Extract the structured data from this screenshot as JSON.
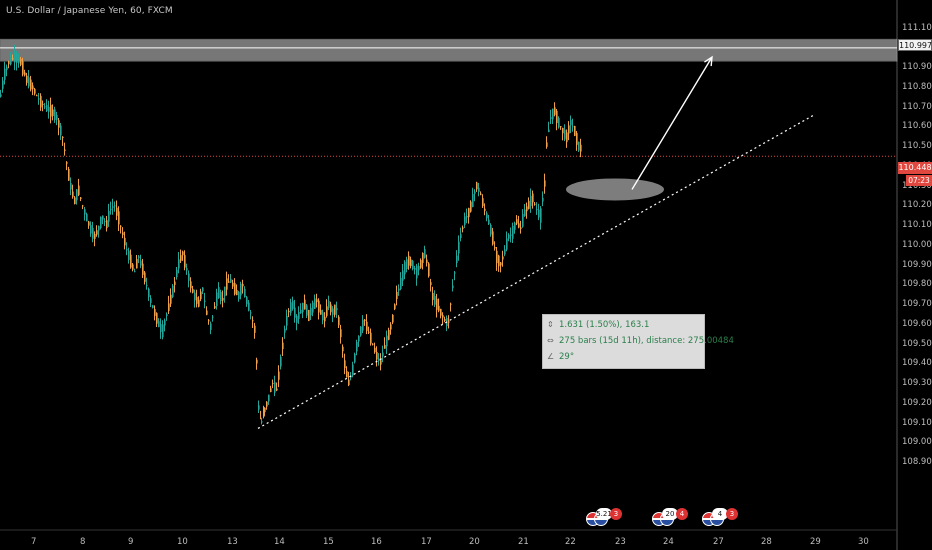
{
  "symbol_title": "U.S. Dollar / Japanese Yen, 60, FXCM",
  "colors": {
    "background": "#000000",
    "candle_up": "#26a69a",
    "candle_down": "#f0a04b",
    "price_line": "#e0483f",
    "zone": "#d9d9d9",
    "trendline": "#ffffff"
  },
  "price_badge": {
    "value": "110.448",
    "countdown": "07:23"
  },
  "level_badge": {
    "value": "110.997"
  },
  "measure": {
    "line1": "1.631 (1.50%), 163.1",
    "line2": "275 bars (15d 11h), distance: 275.00484",
    "line3": "29°",
    "icon1": "vertical-measure-icon",
    "icon2": "horizontal-measure-icon",
    "icon3": "angle-icon"
  },
  "events": [
    {
      "label": "5.21",
      "count": "3"
    },
    {
      "label": "20",
      "count": "4"
    },
    {
      "label": "4",
      "count": "3"
    }
  ],
  "chart_data": {
    "type": "candlestick",
    "ylim": [
      108.85,
      111.18
    ],
    "yticks": [
      "111.100",
      "111.000",
      "110.900",
      "110.800",
      "110.700",
      "110.600",
      "110.500",
      "110.400",
      "110.300",
      "110.200",
      "110.100",
      "110.000",
      "109.900",
      "109.800",
      "109.700",
      "109.600",
      "109.500",
      "109.400",
      "109.300",
      "109.200",
      "109.100",
      "109.000",
      "108.900"
    ],
    "xticks": [
      "7",
      "8",
      "9",
      "10",
      "13",
      "14",
      "15",
      "16",
      "17",
      "20",
      "21",
      "22",
      "23",
      "24",
      "27",
      "28",
      "29",
      "30"
    ],
    "series_path": [
      [
        0,
        110.75
      ],
      [
        4,
        110.86
      ],
      [
        8,
        110.92
      ],
      [
        14,
        110.95
      ],
      [
        20,
        110.93
      ],
      [
        26,
        110.84
      ],
      [
        32,
        110.8
      ],
      [
        38,
        110.74
      ],
      [
        44,
        110.7
      ],
      [
        50,
        110.68
      ],
      [
        56,
        110.65
      ],
      [
        62,
        110.55
      ],
      [
        66,
        110.42
      ],
      [
        70,
        110.3
      ],
      [
        74,
        110.22
      ],
      [
        78,
        110.28
      ],
      [
        82,
        110.2
      ],
      [
        86,
        110.14
      ],
      [
        90,
        110.08
      ],
      [
        94,
        110.04
      ],
      [
        98,
        110.08
      ],
      [
        102,
        110.14
      ],
      [
        106,
        110.1
      ],
      [
        110,
        110.18
      ],
      [
        114,
        110.2
      ],
      [
        118,
        110.14
      ],
      [
        122,
        110.06
      ],
      [
        126,
        109.98
      ],
      [
        130,
        109.92
      ],
      [
        134,
        109.86
      ],
      [
        138,
        109.94
      ],
      [
        142,
        109.88
      ],
      [
        146,
        109.8
      ],
      [
        150,
        109.72
      ],
      [
        154,
        109.66
      ],
      [
        158,
        109.6
      ],
      [
        162,
        109.56
      ],
      [
        166,
        109.64
      ],
      [
        170,
        109.72
      ],
      [
        174,
        109.8
      ],
      [
        178,
        109.9
      ],
      [
        182,
        109.96
      ],
      [
        186,
        109.88
      ],
      [
        190,
        109.8
      ],
      [
        194,
        109.74
      ],
      [
        198,
        109.7
      ],
      [
        202,
        109.78
      ],
      [
        206,
        109.66
      ],
      [
        210,
        109.58
      ],
      [
        214,
        109.68
      ],
      [
        218,
        109.76
      ],
      [
        222,
        109.72
      ],
      [
        226,
        109.8
      ],
      [
        230,
        109.82
      ],
      [
        234,
        109.78
      ],
      [
        238,
        109.74
      ],
      [
        242,
        109.8
      ],
      [
        246,
        109.72
      ],
      [
        250,
        109.66
      ],
      [
        254,
        109.58
      ],
      [
        256,
        109.42
      ],
      [
        258,
        109.18
      ],
      [
        261,
        109.1
      ],
      [
        264,
        109.16
      ],
      [
        268,
        109.22
      ],
      [
        272,
        109.3
      ],
      [
        276,
        109.26
      ],
      [
        280,
        109.4
      ],
      [
        284,
        109.56
      ],
      [
        288,
        109.66
      ],
      [
        292,
        109.7
      ],
      [
        296,
        109.62
      ],
      [
        300,
        109.66
      ],
      [
        304,
        109.7
      ],
      [
        308,
        109.64
      ],
      [
        312,
        109.68
      ],
      [
        316,
        109.72
      ],
      [
        320,
        109.66
      ],
      [
        324,
        109.62
      ],
      [
        328,
        109.7
      ],
      [
        332,
        109.66
      ],
      [
        336,
        109.68
      ],
      [
        340,
        109.56
      ],
      [
        344,
        109.4
      ],
      [
        348,
        109.3
      ],
      [
        352,
        109.36
      ],
      [
        356,
        109.48
      ],
      [
        360,
        109.56
      ],
      [
        364,
        109.62
      ],
      [
        368,
        109.56
      ],
      [
        372,
        109.5
      ],
      [
        376,
        109.44
      ],
      [
        380,
        109.4
      ],
      [
        384,
        109.48
      ],
      [
        388,
        109.54
      ],
      [
        392,
        109.62
      ],
      [
        396,
        109.74
      ],
      [
        400,
        109.8
      ],
      [
        404,
        109.88
      ],
      [
        408,
        109.92
      ],
      [
        412,
        109.9
      ],
      [
        416,
        109.86
      ],
      [
        420,
        109.9
      ],
      [
        424,
        109.96
      ],
      [
        428,
        109.88
      ],
      [
        432,
        109.74
      ],
      [
        436,
        109.7
      ],
      [
        440,
        109.66
      ],
      [
        444,
        109.62
      ],
      [
        448,
        109.6
      ],
      [
        452,
        109.78
      ],
      [
        456,
        109.92
      ],
      [
        460,
        110.04
      ],
      [
        464,
        110.12
      ],
      [
        468,
        110.16
      ],
      [
        472,
        110.22
      ],
      [
        476,
        110.3
      ],
      [
        480,
        110.26
      ],
      [
        484,
        110.18
      ],
      [
        488,
        110.12
      ],
      [
        492,
        110.04
      ],
      [
        496,
        109.94
      ],
      [
        500,
        109.9
      ],
      [
        504,
        109.96
      ],
      [
        508,
        110.04
      ],
      [
        512,
        110.06
      ],
      [
        516,
        110.12
      ],
      [
        520,
        110.08
      ],
      [
        524,
        110.16
      ],
      [
        528,
        110.2
      ],
      [
        532,
        110.24
      ],
      [
        536,
        110.18
      ],
      [
        540,
        110.14
      ],
      [
        544,
        110.3
      ],
      [
        546,
        110.5
      ],
      [
        550,
        110.64
      ],
      [
        554,
        110.68
      ],
      [
        558,
        110.62
      ],
      [
        562,
        110.58
      ],
      [
        566,
        110.54
      ],
      [
        570,
        110.62
      ],
      [
        574,
        110.58
      ],
      [
        578,
        110.5
      ],
      [
        582,
        110.48
      ]
    ],
    "resistance_zone": [
      110.93,
      111.04
    ],
    "price_line": 110.448,
    "trendline": {
      "from": [
        258,
        109.07
      ],
      "to": [
        815,
        110.66
      ]
    },
    "projection_arrow": {
      "from": [
        632,
        110.28
      ],
      "to": [
        712,
        110.95
      ]
    },
    "target_ellipse": {
      "cx": 615,
      "cy": 110.28
    }
  }
}
